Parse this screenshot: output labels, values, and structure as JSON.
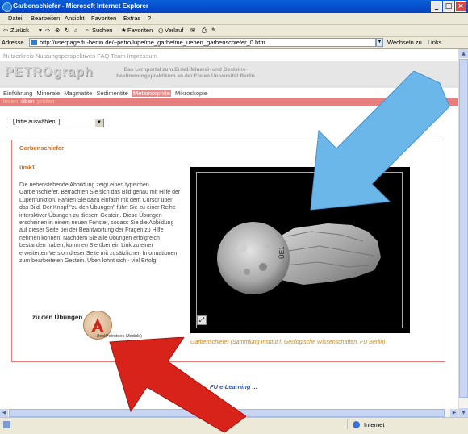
{
  "window": {
    "title": "Garbenschiefer - Microsoft Internet Explorer"
  },
  "menu": [
    "Datei",
    "Bearbeiten",
    "Ansicht",
    "Favoriten",
    "Extras",
    "?"
  ],
  "toolbar": {
    "back": "Zurück",
    "search": "Suchen",
    "favorites": "Favoriten",
    "history": "Verlauf"
  },
  "address": {
    "label": "Adresse",
    "url": "http://userpage.fu-berlin.de/~petro/lupe/me_garbe/me_ueben_garbenschiefer_0.htm",
    "go": "Wechseln zu",
    "links": "Links"
  },
  "page": {
    "topnav": "Nutzerkreis Nutzungsperspektiven FAQ Team Impressum",
    "logo": "PETROgraph",
    "subtitle": "Das Lernportal zum Erde1-Mineral- und Gesteins-bestimmungspraktikum an der Freien Universität Berlin",
    "mainnav": [
      {
        "label": "Einführung",
        "active": false
      },
      {
        "label": "Minerale",
        "active": false
      },
      {
        "label": "Magmatite",
        "active": false
      },
      {
        "label": "Sedimentite",
        "active": false
      },
      {
        "label": "Metamorphite",
        "active": true
      },
      {
        "label": "Mikroskopie",
        "active": false
      }
    ],
    "subnav": {
      "item1": "lesen",
      "item2": "üben",
      "item3": "prüfen"
    },
    "select_value": "[ bitte auswählen! ]",
    "heading": "Garbenschiefer",
    "subheading": "ümk1",
    "description": "Die nebenstehende Abbildung zeigt einen typischen Garbenschiefer. Betrachten Sie sich das Bild genau mit Hilfe der Lupenfunktion. Fahren Sie dazu einfach mit dem Cursor über das Bild. Der Knopf \"zu den Übungen\" führt Sie zu einer Reihe interaktiver Übungen zu diesem Gestein. Diese Übungen erscheinen in einem neuen Fenster, sodass Sie die Abbildung auf dieser Seite bei der Beantwortung der Fragen zu Hilfe nehmen können. Nachdem Sie alle Übungen erfolgreich bestanden haben, kommen Sie über ein Link zu einer erweiterten Version dieser Seite mit zusätzlichen Informationen zum bearbeiteten Gestein. Üben lohnt sich - viel Erfolg!",
    "exercise_button": "zu den Übungen",
    "exercise_caption": "(testPetrotoes-Module)",
    "image_caption": "Garbenschiefer (Sammlung Institut f. Geologische Wissenschaften, FU Berlin)",
    "elearning": "FU e-Learning ..."
  },
  "status": {
    "zone": "Internet"
  },
  "colors": {
    "accent": "#e77b7b",
    "heading": "#d06a1e",
    "arrow_blue": "#6bb7ea",
    "arrow_red": "#d8231b"
  }
}
